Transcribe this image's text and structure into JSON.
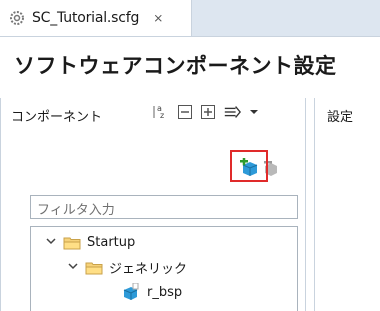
{
  "tab": {
    "title": "SC_Tutorial.scfg",
    "close": "⨯"
  },
  "heading": "ソフトウェアコンポーネント設定",
  "components_panel": {
    "title": "コンポーネント",
    "filter_placeholder": "フィルタ入力",
    "toolbar_icons": [
      "sort-alpha-icon",
      "collapse-all-icon",
      "expand-all-icon",
      "filter-icon",
      "dropdown-icon"
    ],
    "action_icons": [
      "add-component-icon",
      "remove-component-icon"
    ],
    "highlight_color": "#e02a2a",
    "tree": [
      {
        "label": "Startup",
        "level": 0,
        "expanded": true,
        "icon": "folder-icon"
      },
      {
        "label": "ジェネリック",
        "level": 1,
        "expanded": true,
        "icon": "folder-icon"
      },
      {
        "label": "r_bsp",
        "level": 2,
        "icon": "component-icon"
      }
    ]
  },
  "settings_panel": {
    "title": "設定"
  }
}
